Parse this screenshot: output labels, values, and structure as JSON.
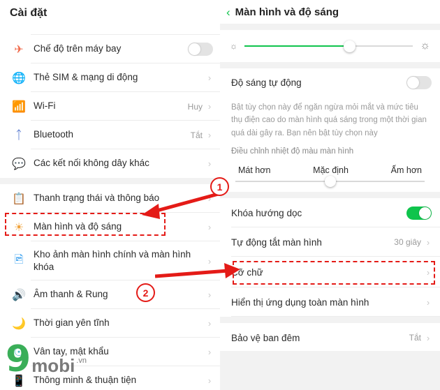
{
  "left": {
    "title": "Cài đặt",
    "items": [
      {
        "label": "Chế độ trên máy bay",
        "icon": "airplane-icon",
        "control": "toggle-off",
        "value": ""
      },
      {
        "label": "Thẻ SIM & mạng di động",
        "icon": "globe-icon",
        "control": "chevron",
        "value": ""
      },
      {
        "label": "Wi-Fi",
        "icon": "wifi-icon",
        "control": "chevron",
        "value": "Huy"
      },
      {
        "label": "Bluetooth",
        "icon": "bluetooth-icon",
        "control": "chevron",
        "value": "Tắt"
      },
      {
        "label": "Các kết nối không dây khác",
        "icon": "dots-icon",
        "control": "chevron",
        "value": ""
      },
      {
        "label": "Thanh trạng thái và thông báo",
        "icon": "notification-icon",
        "control": "chevron",
        "value": ""
      },
      {
        "label": "Màn hình và độ sáng",
        "icon": "brightness-icon",
        "control": "chevron",
        "value": ""
      },
      {
        "label": "Kho ảnh màn hình chính và màn hình khóa",
        "icon": "gallery-icon",
        "control": "chevron",
        "value": ""
      },
      {
        "label": "Âm thanh & Rung",
        "icon": "sound-icon",
        "control": "chevron",
        "value": ""
      },
      {
        "label": "Thời gian yên tĩnh",
        "icon": "moon-icon",
        "control": "chevron",
        "value": ""
      },
      {
        "label": "Vân tay, mật khẩu",
        "icon": "fingerprint-icon",
        "control": "chevron",
        "value": ""
      },
      {
        "label": "Thông minh & thuận tiện",
        "icon": "smart-icon",
        "control": "chevron",
        "value": ""
      }
    ]
  },
  "right": {
    "title": "Màn hình và độ sáng",
    "back_icon": "back-chevron-icon",
    "brightness": {
      "low_icon": "sun-small-icon",
      "high_icon": "sun-large-icon",
      "percent": 62
    },
    "auto_brightness": {
      "label": "Độ sáng tự động",
      "state": "off"
    },
    "auto_brightness_desc": "Bật tùy chọn này để ngăn ngừa mỏi mắt và mức tiêu thụ điện cao do màn hình quá sáng trong một thời gian quá dài gây ra. Bạn nên bật tùy chọn này",
    "color_temp_label": "Điều chỉnh nhiệt độ màu màn hình",
    "color_temp": {
      "left": "Mát hơn",
      "center": "Mặc định",
      "right": "Ấm hơn",
      "position": 50
    },
    "rows": [
      {
        "label": "Khóa hướng dọc",
        "control": "toggle-on",
        "value": ""
      },
      {
        "label": "Tự động tắt màn hình",
        "control": "chevron",
        "value": "30 giây"
      },
      {
        "label": "Cỡ chữ",
        "control": "chevron",
        "value": ""
      },
      {
        "label": "Hiển thị ứng dụng toàn màn hình",
        "control": "chevron",
        "value": ""
      },
      {
        "label": "Bảo vệ ban đêm",
        "control": "chevron",
        "value": "Tắt"
      }
    ]
  },
  "annotations": {
    "markers": [
      {
        "id": "marker-1",
        "label": "1"
      },
      {
        "id": "marker-2",
        "label": "2"
      }
    ],
    "highlight_color": "#e41b17"
  },
  "watermark": {
    "digit": "9",
    "name": "mobi",
    "tld": ".vn"
  }
}
